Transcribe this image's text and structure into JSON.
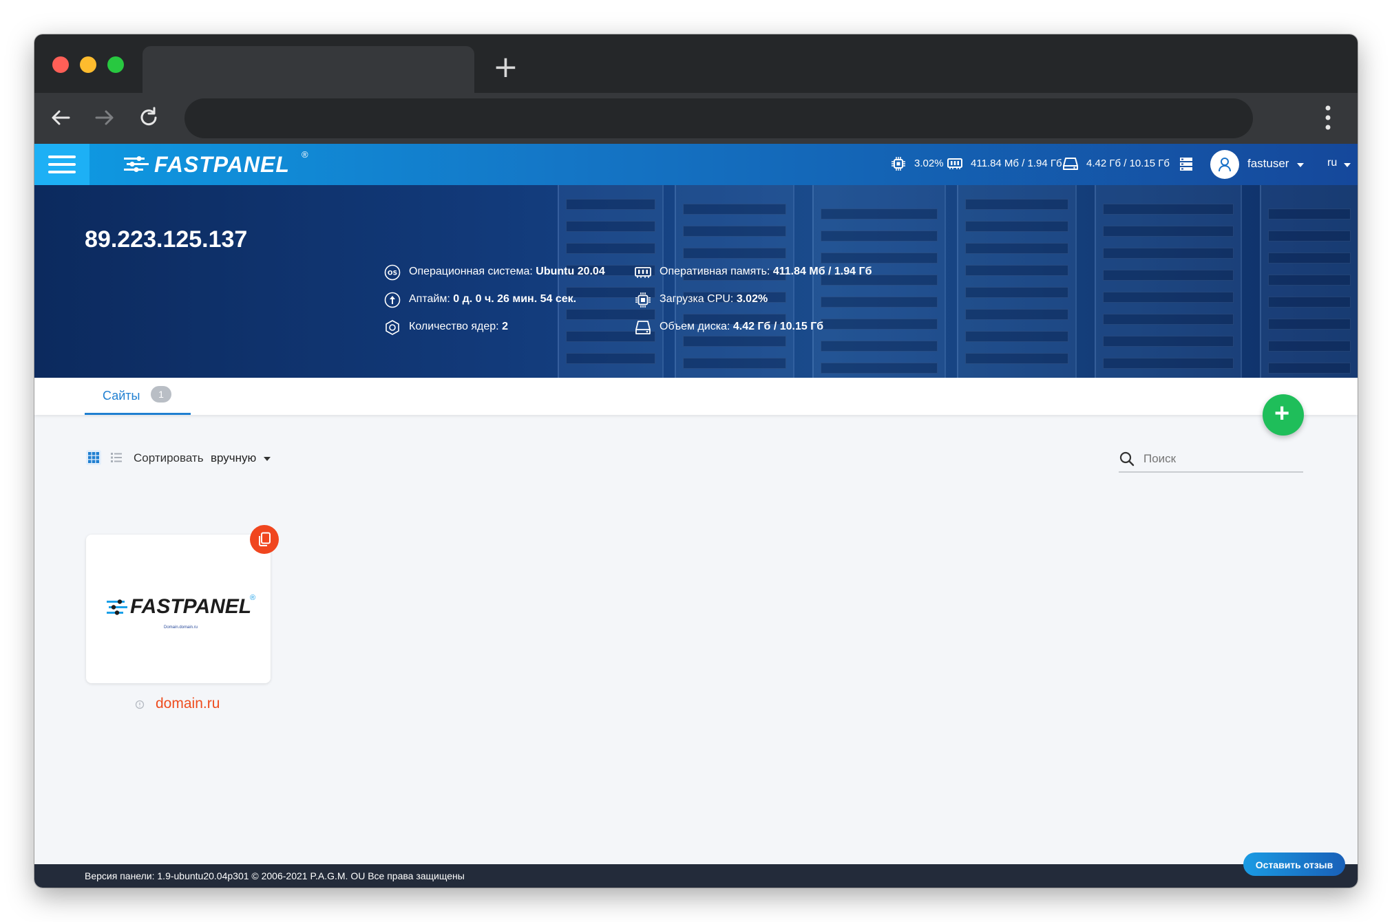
{
  "browser": {
    "new_tab_label": "+"
  },
  "header": {
    "logo_text": "FASTPANEL",
    "logo_mark": "®",
    "cpu": "3.02%",
    "ram": "411.84 Мб / 1.94 Гб",
    "disk": "4.42 Гб / 10.15 Гб",
    "username": "fastuser",
    "language": "ru"
  },
  "hero": {
    "ip": "89.223.125.137",
    "os_label": "Операционная система:",
    "os_value": "Ubuntu 20.04",
    "uptime_label": "Аптайм:",
    "uptime_value": "0 д. 0 ч. 26 мин. 54 сек.",
    "cores_label": "Количество ядер:",
    "cores_value": "2",
    "ram_label": "Оперативная память:",
    "ram_value": "411.84 Мб / 1.94 Гб",
    "cpu_label": "Загрузка CPU:",
    "cpu_value": "3.02%",
    "disk_label": "Объем диска:",
    "disk_value": "4.42 Гб / 10.15 Гб"
  },
  "tabs": {
    "sites_label": "Сайты",
    "sites_count": "1"
  },
  "toolbar": {
    "sort_label": "Сортировать",
    "sort_value": "вручную",
    "search_placeholder": "Поиск"
  },
  "sites": [
    {
      "name": "domain.ru",
      "preview_logo": "FASTPANEL",
      "preview_mark": "®",
      "preview_sub": "Domain.domain.ru"
    }
  ],
  "footer": {
    "text": "Версия панели: 1.9-ubuntu20.04p301 © 2006-2021 P.A.G.M. OU Все права защищены",
    "feedback_label": "Оставить отзыв"
  },
  "colors": {
    "accent": "#1f7fd1",
    "header_start": "#0e9be3",
    "header_end": "#15489b",
    "fab": "#1fbe5a",
    "site_link": "#ee4c1e",
    "footer_bg": "#232b3a"
  }
}
